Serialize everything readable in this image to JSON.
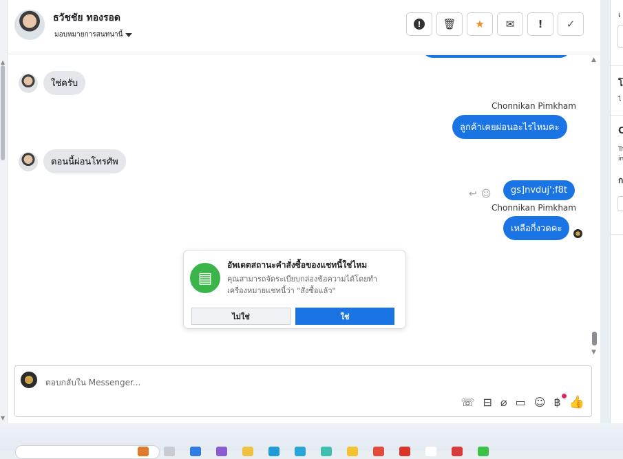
{
  "header": {
    "name": "ธวัชชัย ทองรอด",
    "assign_label": "มอบหมายการสนทนานี้",
    "toolbar": [
      {
        "icon": "alert-circle-icon",
        "glyph": "!"
      },
      {
        "icon": "trash-icon",
        "glyph": "🗑"
      },
      {
        "icon": "star-icon",
        "glyph": "★"
      },
      {
        "icon": "mail-icon",
        "glyph": "✉"
      },
      {
        "icon": "exclamation-icon",
        "glyph": "!"
      },
      {
        "icon": "check-icon",
        "glyph": "✓"
      }
    ]
  },
  "messages": {
    "in1": "ใช่ครับ",
    "sender1": "Chonnikan Pimkham",
    "out1": "ลูกค้าเคยผ่อนอะไรไหมคะ",
    "in2": "ตอนนี้ผ่อนโทรศัพ",
    "out2": "gs]nvduj';f8t",
    "sender2": "Chonnikan Pimkham",
    "out3": "เหลือกี่งวดคะ"
  },
  "card": {
    "title": "อัพเดตสถานะคำสั่งซื้อของแชทนี้ใช่ไหม",
    "description": "คุณสามารถจัดระเบียบกล่องข้อความได้โดยทำเครื่องหมายแชทนี้ว่า \"สั่งซื้อแล้ว\"",
    "no_label": "ไม่ใช่",
    "yes_label": "ใช่"
  },
  "composer": {
    "placeholder": "ตอบกลับใน Messenger..."
  },
  "right_panel": {
    "t1": "เ",
    "t2": "โ",
    "t3": "ไ",
    "t4": "C",
    "t5": "Tr",
    "t6": "in",
    "t7": "ก"
  },
  "colors": {
    "accent": "#1b74e4",
    "card_icon": "#3bb54a"
  }
}
